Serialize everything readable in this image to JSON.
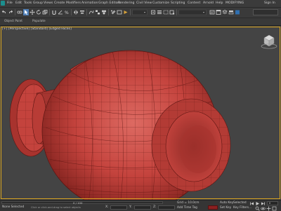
{
  "menu": {
    "items": [
      "File",
      "Edit",
      "Tools",
      "Group",
      "Views",
      "Create",
      "Modifiers",
      "Animation",
      "Graph Editors",
      "Rendering",
      "Civil View",
      "Customize",
      "Scripting",
      "Content",
      "Arnold",
      "Help",
      "MODIFYING"
    ],
    "sign_in": "Sign In"
  },
  "toolbar": {
    "workspace": "Workspaces: Default",
    "view_dropdown": "View",
    "selection_set": "Create Selection Set"
  },
  "ribbon": {
    "tabs": [
      "Object Paint",
      "Populate"
    ]
  },
  "viewport": {
    "label": "[+] [Perspective] [Standard] [Edged Faces]",
    "model_color": "#c4433d",
    "edge_color": "#5a1512",
    "background": "#444444",
    "active_border": "#d9a520"
  },
  "status": {
    "frame_counter": "0 / 100",
    "selection": "None Selected",
    "prompt": "Click or click-and-drag to select objects",
    "grid": "Grid = 10.0cm",
    "add_time_tag": "Add Time Tag",
    "auto_key": "Auto Key",
    "set_key": "Set Key",
    "selected": "Selected",
    "x_label": "X:",
    "y_label": "Y:",
    "z_label": "Z:",
    "key_filters": "Key Filters...",
    "frame": "0"
  },
  "icons": [
    "undo-icon",
    "redo-icon",
    "link-icon",
    "unlink-icon",
    "select-icon",
    "move-icon",
    "rotate-icon",
    "scale-icon",
    "snap-icon",
    "render-icon",
    "viewcube-icon"
  ]
}
